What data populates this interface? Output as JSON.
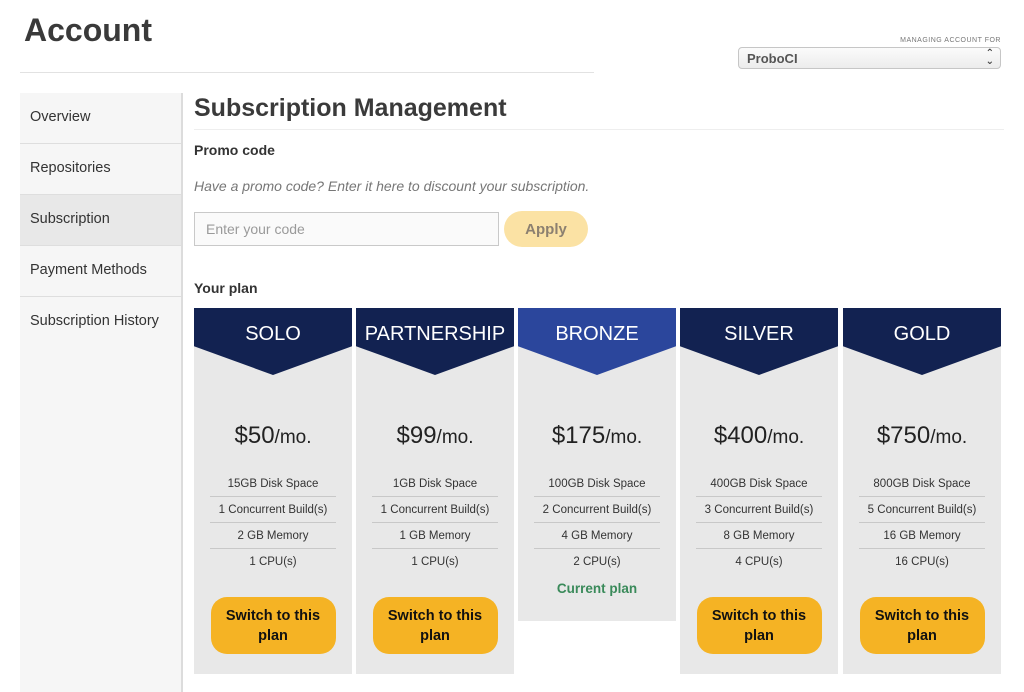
{
  "header": {
    "title": "Account",
    "managing_label": "MANAGING ACCOUNT FOR",
    "account_selected": "ProboCI"
  },
  "sidebar": {
    "items": [
      {
        "label": "Overview"
      },
      {
        "label": "Repositories"
      },
      {
        "label": "Subscription",
        "active": true
      },
      {
        "label": "Payment Methods"
      },
      {
        "label": "Subscription History"
      }
    ]
  },
  "main": {
    "title": "Subscription Management",
    "promo": {
      "heading": "Promo code",
      "help": "Have a promo code? Enter it here to discount your subscription.",
      "placeholder": "Enter your code",
      "value": "",
      "apply_label": "Apply"
    },
    "plan_heading": "Your plan",
    "plans": [
      {
        "name": "SOLO",
        "price": "$50",
        "per": "/mo.",
        "features": [
          "15GB Disk Space",
          "1 Concurrent Build(s)",
          "2 GB Memory",
          "1 CPU(s)"
        ],
        "action": "Switch to this plan",
        "current": false
      },
      {
        "name": "PARTNERSHIP",
        "price": "$99",
        "per": "/mo.",
        "features": [
          "1GB Disk Space",
          "1 Concurrent Build(s)",
          "1 GB Memory",
          "1 CPU(s)"
        ],
        "action": "Switch to this plan",
        "current": false
      },
      {
        "name": "BRONZE",
        "price": "$175",
        "per": "/mo.",
        "features": [
          "100GB Disk Space",
          "2 Concurrent Build(s)",
          "4 GB Memory",
          "2 CPU(s)"
        ],
        "current_label": "Current plan",
        "current": true
      },
      {
        "name": "SILVER",
        "price": "$400",
        "per": "/mo.",
        "features": [
          "400GB Disk Space",
          "3 Concurrent Build(s)",
          "8 GB Memory",
          "4 CPU(s)"
        ],
        "action": "Switch to this plan",
        "current": false
      },
      {
        "name": "GOLD",
        "price": "$750",
        "per": "/mo.",
        "features": [
          "800GB Disk Space",
          "5 Concurrent Build(s)",
          "16 GB Memory",
          "16 CPU(s)"
        ],
        "action": "Switch to this plan",
        "current": false
      }
    ]
  },
  "colors": {
    "banner": "#122251",
    "banner_current": "#2b469c",
    "switch_button": "#f5b324",
    "apply_button": "#fbe2a4",
    "current_plan_text": "#3a8a5a"
  }
}
